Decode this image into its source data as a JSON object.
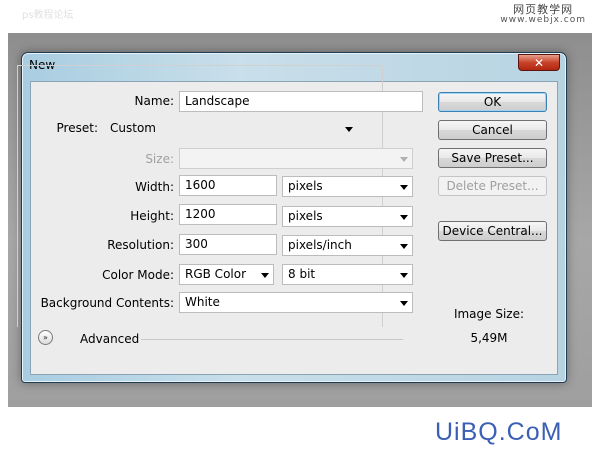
{
  "watermarks": {
    "top_left": "ps教程论坛",
    "top_right_line1": "网页教学网",
    "top_right_line2": "www.webjx.com",
    "bottom": "UiBQ.CoM"
  },
  "dialog": {
    "title": "New",
    "close_glyph": "✕"
  },
  "form": {
    "name": {
      "label": "Name:",
      "value": "Landscape"
    },
    "preset": {
      "label": "Preset:",
      "value": "Custom"
    },
    "size": {
      "label": "Size:",
      "value": ""
    },
    "width": {
      "label": "Width:",
      "value": "1600",
      "unit": "pixels"
    },
    "height": {
      "label": "Height:",
      "value": "1200",
      "unit": "pixels"
    },
    "resolution": {
      "label": "Resolution:",
      "value": "300",
      "unit": "pixels/inch"
    },
    "color_mode": {
      "label": "Color Mode:",
      "value": "RGB Color",
      "depth": "8 bit"
    },
    "background": {
      "label": "Background Contents:",
      "value": "White"
    },
    "advanced": {
      "label": "Advanced",
      "icon": "»"
    }
  },
  "buttons": {
    "ok": "OK",
    "cancel": "Cancel",
    "save_preset": "Save Preset...",
    "delete_preset": "Delete Preset...",
    "device_central": "Device Central..."
  },
  "image_size": {
    "label": "Image Size:",
    "value": "5,49M"
  },
  "icons": {
    "close": "close-icon",
    "dropdown": "chevron-down-icon",
    "advanced_toggle": "double-chevron-down-icon"
  },
  "colors": {
    "window_frame": "#b7d3e2",
    "close_button": "#c8432b",
    "dialog_face": "#ececec"
  }
}
